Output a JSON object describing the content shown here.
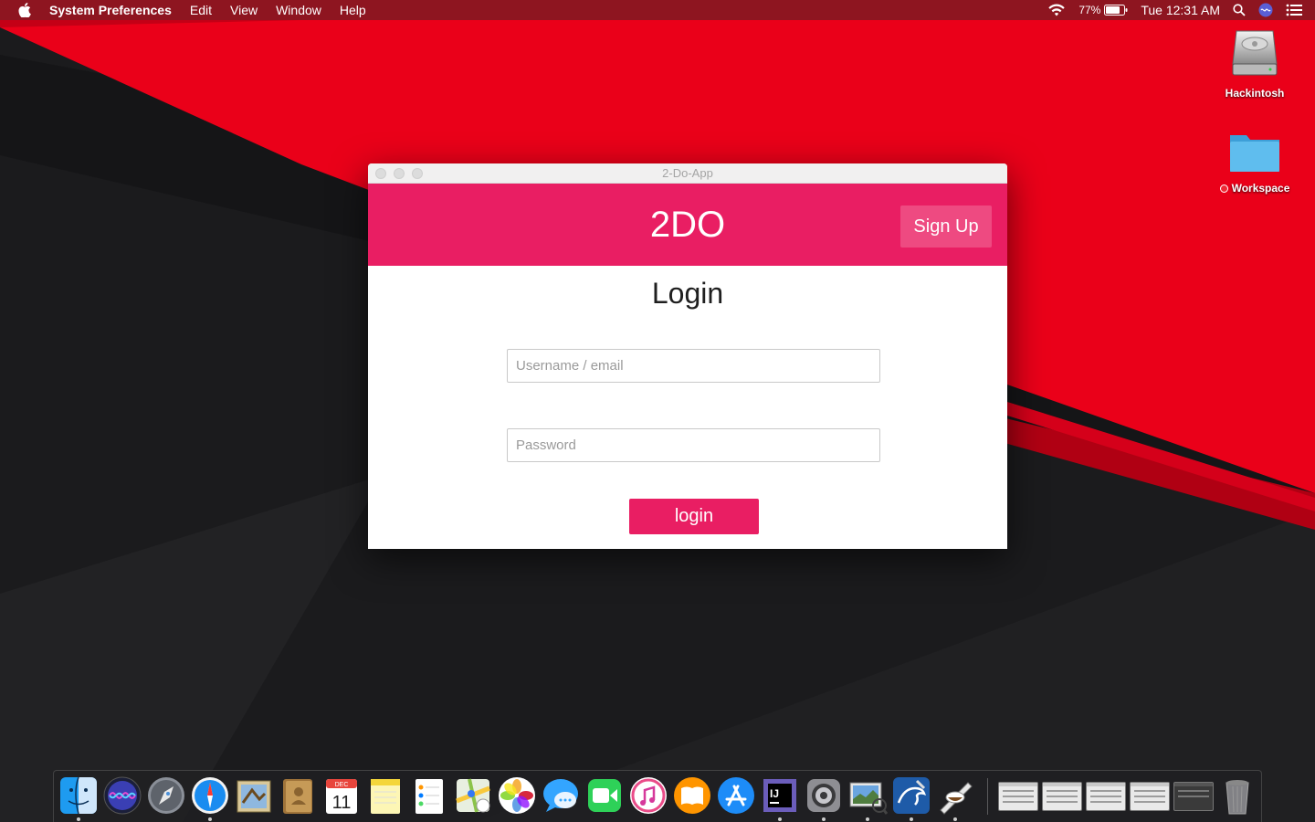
{
  "menubar": {
    "app_name": "System Preferences",
    "menus": [
      "Edit",
      "View",
      "Window",
      "Help"
    ],
    "battery_percent": "77%",
    "clock": "Tue 12:31 AM"
  },
  "desktop": {
    "icons": [
      {
        "label": "Hackintosh",
        "icon": "hard-drive-icon"
      },
      {
        "label": "Workspace",
        "icon": "folder-icon",
        "tag_color": "#ee2a36"
      }
    ]
  },
  "window": {
    "title": "2-Do-App",
    "header": {
      "brand": "2DO",
      "signup_label": "Sign Up"
    },
    "login": {
      "heading": "Login",
      "username_placeholder": "Username / email",
      "password_placeholder": "Password",
      "button_label": "login"
    }
  },
  "colors": {
    "accent": "#e91e63",
    "signup_bg": "#ee4a81",
    "menubar": "#8e1520",
    "wallpaper_red": "#ea0019",
    "wallpaper_dark": "#1b1b1d"
  },
  "dock": {
    "apps": [
      "finder-icon",
      "siri-icon",
      "launchpad-icon",
      "safari-icon",
      "mail-icon",
      "contacts-icon",
      "calendar-icon",
      "notes-icon",
      "reminders-icon",
      "maps-icon",
      "photos-icon",
      "messages-icon",
      "facetime-icon",
      "itunes-icon",
      "ibooks-icon",
      "app-store-icon",
      "intellij-icon",
      "system-preferences-icon",
      "preview-icon",
      "mysql-workbench-icon",
      "script-editor-icon"
    ],
    "calendar": {
      "month": "DEC",
      "day": "11"
    },
    "intellij_text": "IJ",
    "minimized_windows": 5
  }
}
